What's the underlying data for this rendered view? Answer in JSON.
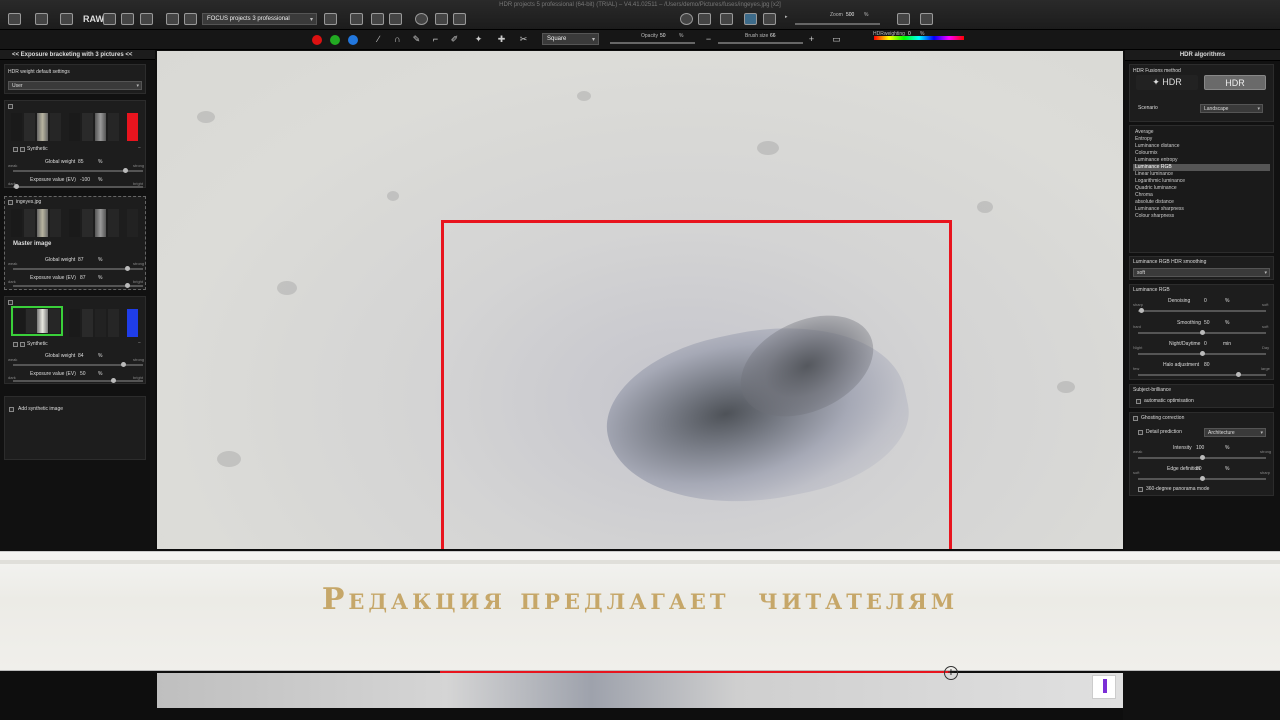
{
  "titlebar": {
    "title": "HDR projects 5 professional (64-bit) (TRIAL) – V4.41.02511 – /Users/demo/Pictures/fuses/ingeyes.jpg [x2]",
    "raw_label": "RAW",
    "app_select": "FOCUS projects 3 professional",
    "zoom_label": "Zoom",
    "zoom_value": "500",
    "zoom_unit": "%"
  },
  "toolbar2": {
    "mask_shape": "Square",
    "opacity_label": "Opacity",
    "opacity_value": "50",
    "opacity_unit": "%",
    "brush_label": "Brush size",
    "brush_value": "66",
    "hdr_weighting_label": "HDRweighting",
    "hdr_weighting_value": "0",
    "hdr_weighting_unit": "%"
  },
  "left_panel": {
    "header": "<< Exposure bracketing with 3 pictures <<",
    "weight_settings_label": "HDR weight default settings",
    "weight_settings_value": "User",
    "images": [
      {
        "name": "Synthetic",
        "global_weight_label": "Global weight",
        "global_weight": "85",
        "ev_label": "Exposure value (EV)",
        "ev": "-100",
        "unit": "%",
        "accent": "#e8141e"
      },
      {
        "name": "ingeyes.jpg",
        "master_label": "Master image",
        "global_weight_label": "Global weight",
        "global_weight": "87",
        "ev_label": "Exposure value (EV)",
        "ev": "87",
        "unit": "%"
      },
      {
        "name": "Synthetic",
        "global_weight_label": "Global weight",
        "global_weight": "84",
        "ev_label": "Exposure value (EV)",
        "ev": "50",
        "unit": "%",
        "accent": "#1f3de8"
      }
    ],
    "small_labels": {
      "weak": "weak",
      "strong": "strong",
      "dark": "dark",
      "bright": "bright"
    },
    "add_synthetic": "Add synthetic image"
  },
  "right_panel": {
    "title": "HDR algorithms",
    "fusion_method_label": "HDR Fusions method",
    "hdr_button": "HDR",
    "tonemap_button": "HDR",
    "scenario_label": "Scenario",
    "scenario_value": "Landscape",
    "methods": [
      "Average",
      "Entropy",
      "Luminance distance",
      "Colourmix",
      "Luminance entropy",
      "Luminance RGB",
      "Linear luminance",
      "Logarithmic luminance",
      "Quadric luminance",
      "Chroma",
      "absolute distance",
      "Luminance sharpness",
      "Colour sharpness"
    ],
    "selected_method": "Luminance RGB",
    "smoothing_label": "Luminance RGB HDR smoothing",
    "smoothing_value": "soft",
    "lum_rgb_label": "Luminance RGB",
    "sliders": [
      {
        "name": "Denoising",
        "value": "0",
        "unit": "%",
        "left": "sharp",
        "right": "soft"
      },
      {
        "name": "Smoothing",
        "value": "50",
        "unit": "%",
        "left": "hard",
        "right": "soft"
      },
      {
        "name": "Night/Daytime",
        "value": "0",
        "unit": "min",
        "left": "Night",
        "right": "Day"
      },
      {
        "name": "Halo adjustment",
        "value": "80",
        "unit": "",
        "left": "few",
        "right": "large"
      }
    ],
    "subject_brilliance_label": "Subject-brilliance",
    "auto_opt_label": "automatic optimisation",
    "ghosting_label": "Ghosting correction",
    "detail_prediction_label": "Detail prediction",
    "detail_prediction_value": "Architecture",
    "intensity_label": "Intensity",
    "intensity_value": "100",
    "intensity_unit": "%",
    "intensity_left": "weak",
    "intensity_right": "strong",
    "edge_label": "Edge definition",
    "edge_value": "80",
    "edge_unit": "%",
    "edge_left": "soft",
    "edge_right": "sharp",
    "panorama_label": "360-degree panorama mode"
  },
  "banner": {
    "text": "Редакция предлагает  читателям"
  }
}
